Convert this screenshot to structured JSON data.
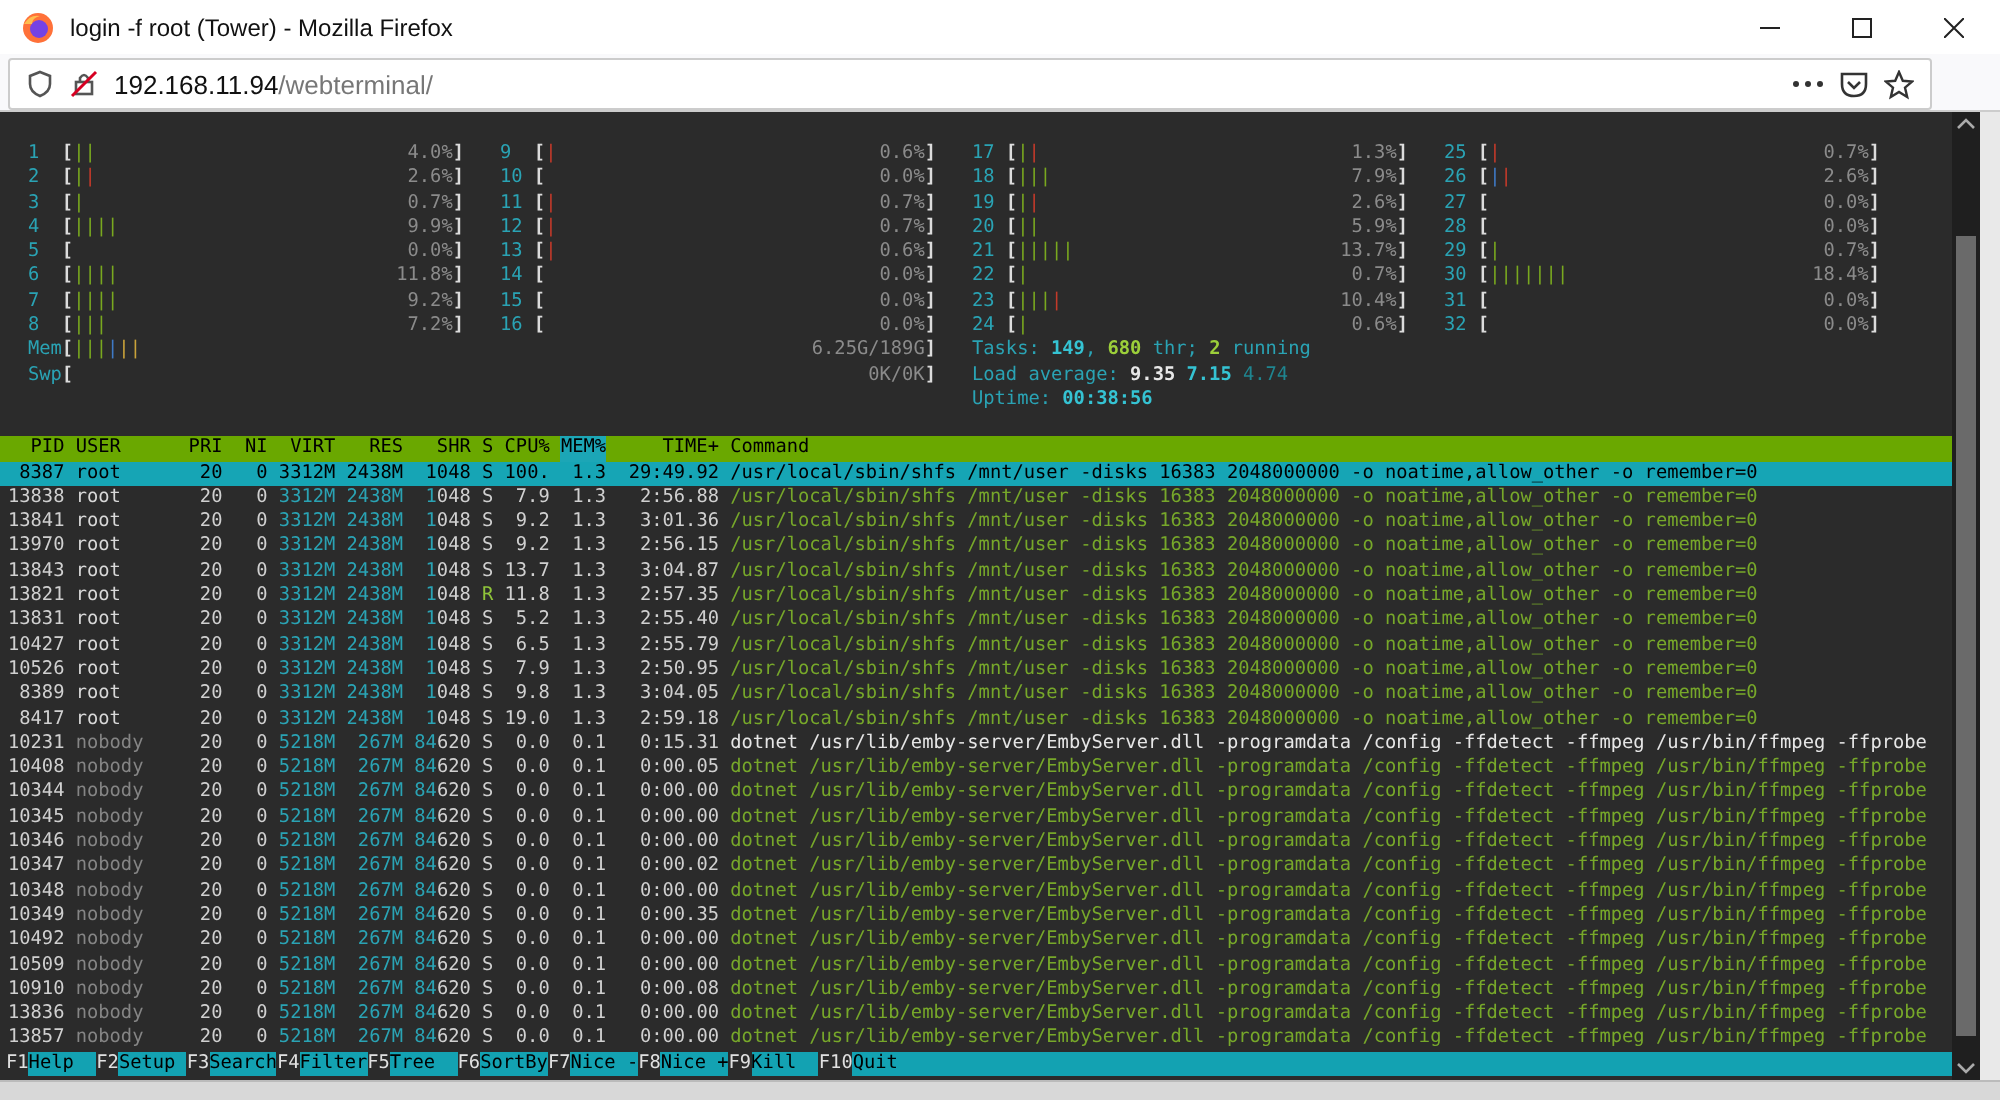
{
  "window": {
    "title": "login -f root (Tower) - Mozilla Firefox"
  },
  "address_bar": {
    "host": "192.168.11.94",
    "path": "/webterminal/"
  },
  "terminal": {
    "cpu_meters": [
      {
        "label": "1",
        "open": "[",
        "bars": [
          {
            "kind": "normal",
            "text": "||"
          }
        ],
        "reading": "4.0%",
        "close": "]"
      },
      {
        "label": "2",
        "open": "[",
        "bars": [
          {
            "kind": "normal",
            "text": "|"
          },
          {
            "kind": "kernel",
            "text": "|"
          }
        ],
        "reading": "2.6%",
        "close": "]"
      },
      {
        "label": "3",
        "open": "[",
        "bars": [
          {
            "kind": "normal",
            "text": "|"
          }
        ],
        "reading": "0.7%",
        "close": "]"
      },
      {
        "label": "4",
        "open": "[",
        "bars": [
          {
            "kind": "normal",
            "text": "||||"
          }
        ],
        "reading": "9.9%",
        "close": "]"
      },
      {
        "label": "5",
        "open": "[",
        "reading": "0.0%",
        "close": "]"
      },
      {
        "label": "6",
        "open": "[",
        "bars": [
          {
            "kind": "normal",
            "text": "||||"
          }
        ],
        "reading": "11.8%",
        "close": "]"
      },
      {
        "label": "7",
        "open": "[",
        "bars": [
          {
            "kind": "normal",
            "text": "||||"
          }
        ],
        "reading": "9.2%",
        "close": "]"
      },
      {
        "label": "8",
        "open": "[",
        "bars": [
          {
            "kind": "normal",
            "text": "|||"
          }
        ],
        "reading": "7.2%",
        "close": "]"
      },
      {
        "label": "9",
        "open": "[",
        "bars": [
          {
            "kind": "kernel",
            "text": "|"
          }
        ],
        "reading": "0.6%",
        "close": "]"
      },
      {
        "label": "10",
        "open": "[",
        "reading": "0.0%",
        "close": "]"
      },
      {
        "label": "11",
        "open": "[",
        "bars": [
          {
            "kind": "kernel",
            "text": "|"
          }
        ],
        "reading": "0.7%",
        "close": "]"
      },
      {
        "label": "12",
        "open": "[",
        "bars": [
          {
            "kind": "kernel",
            "text": "|"
          }
        ],
        "reading": "0.7%",
        "close": "]"
      },
      {
        "label": "13",
        "open": "[",
        "bars": [
          {
            "kind": "kernel",
            "text": "|"
          }
        ],
        "reading": "0.6%",
        "close": "]"
      },
      {
        "label": "14",
        "open": "[",
        "reading": "0.0%",
        "close": "]"
      },
      {
        "label": "15",
        "open": "[",
        "reading": "0.0%",
        "close": "]"
      },
      {
        "label": "16",
        "open": "[",
        "reading": "0.0%",
        "close": "]"
      },
      {
        "label": "17",
        "open": "[",
        "bars": [
          {
            "kind": "normal",
            "text": "|"
          },
          {
            "kind": "kernel",
            "text": "|"
          }
        ],
        "reading": "1.3%",
        "close": "]"
      },
      {
        "label": "18",
        "open": "[",
        "bars": [
          {
            "kind": "normal",
            "text": "|||"
          }
        ],
        "reading": "7.9%",
        "close": "]"
      },
      {
        "label": "19",
        "open": "[",
        "bars": [
          {
            "kind": "normal",
            "text": "|"
          },
          {
            "kind": "kernel",
            "text": "|"
          }
        ],
        "reading": "2.6%",
        "close": "]"
      },
      {
        "label": "20",
        "open": "[",
        "bars": [
          {
            "kind": "normal",
            "text": "||"
          }
        ],
        "reading": "5.9%",
        "close": "]"
      },
      {
        "label": "21",
        "open": "[",
        "bars": [
          {
            "kind": "normal",
            "text": "|||||"
          }
        ],
        "reading": "13.7%",
        "close": "]"
      },
      {
        "label": "22",
        "open": "[",
        "bars": [
          {
            "kind": "normal",
            "text": "|"
          }
        ],
        "reading": "0.7%",
        "close": "]"
      },
      {
        "label": "23",
        "open": "[",
        "bars": [
          {
            "kind": "normal",
            "text": "|||"
          },
          {
            "kind": "kernel",
            "text": "|"
          }
        ],
        "reading": "10.4%",
        "close": "]"
      },
      {
        "label": "24",
        "open": "[",
        "bars": [
          {
            "kind": "normal",
            "text": "|"
          }
        ],
        "reading": "0.6%",
        "close": "]"
      },
      {
        "label": "25",
        "open": "[",
        "bars": [
          {
            "kind": "kernel",
            "text": "|"
          }
        ],
        "reading": "0.7%",
        "close": "]"
      },
      {
        "label": "26",
        "open": "[",
        "bars": [
          {
            "kind": "low",
            "text": "|"
          },
          {
            "kind": "kernel",
            "text": "|"
          }
        ],
        "reading": "2.6%",
        "close": "]"
      },
      {
        "label": "27",
        "open": "[",
        "reading": "0.0%",
        "close": "]"
      },
      {
        "label": "28",
        "open": "[",
        "reading": "0.0%",
        "close": "]"
      },
      {
        "label": "29",
        "open": "[",
        "bars": [
          {
            "kind": "normal",
            "text": "|"
          }
        ],
        "reading": "0.7%",
        "close": "]"
      },
      {
        "label": "30",
        "open": "[",
        "bars": [
          {
            "kind": "normal",
            "text": "|||||||"
          }
        ],
        "reading": "18.4%",
        "close": "]"
      },
      {
        "label": "31",
        "open": "[",
        "reading": "0.0%",
        "close": "]"
      },
      {
        "label": "32",
        "open": "[",
        "reading": "0.0%",
        "close": "]"
      }
    ],
    "memory_meters": [
      {
        "label": "Mem",
        "open": "[",
        "bars": [
          {
            "kind": "normal",
            "text": "|||"
          },
          {
            "kind": "low",
            "text": "|"
          },
          {
            "kind": "cache",
            "text": "||"
          }
        ],
        "reading": "6.25G/189G",
        "close": "]"
      },
      {
        "label": "Swp",
        "open": "[",
        "reading": "0K/0K",
        "close": "]"
      }
    ],
    "summary": [
      {
        "segments": [
          {
            "kind": "label",
            "text": "Tasks: "
          },
          {
            "kind": "value",
            "text": "149"
          },
          {
            "kind": "label",
            "text": ", "
          },
          {
            "kind": "accent",
            "text": "680"
          },
          {
            "kind": "label",
            "text": " thr; "
          },
          {
            "kind": "accent",
            "text": "2"
          },
          {
            "kind": "label",
            "text": " running"
          }
        ]
      },
      {
        "segments": [
          {
            "kind": "label",
            "text": "Load average: "
          },
          {
            "kind": "bright",
            "text": "9.35 "
          },
          {
            "kind": "value",
            "text": "7.15 "
          },
          {
            "kind": "dim",
            "text": "4.74"
          }
        ]
      },
      {
        "segments": [
          {
            "kind": "label",
            "text": "Uptime: "
          },
          {
            "kind": "value",
            "text": "00:38:56"
          }
        ]
      }
    ],
    "table": {
      "columns": [
        {
          "label": "PID",
          "selected": false
        },
        {
          "label": "USER",
          "selected": false
        },
        {
          "label": "PRI",
          "selected": false
        },
        {
          "label": "NI",
          "selected": false
        },
        {
          "label": "VIRT",
          "selected": false
        },
        {
          "label": "RES",
          "selected": false
        },
        {
          "label": "SHR",
          "selected": false
        },
        {
          "label": "S",
          "selected": false
        },
        {
          "label": "CPU%",
          "selected": false
        },
        {
          "label": "MEM%",
          "selected": true
        },
        {
          "label": "TIME+",
          "selected": false
        },
        {
          "label": "Command",
          "selected": false
        }
      ],
      "rows": [
        {
          "pid": "8387",
          "user": "root",
          "pri": "20",
          "ni": "0",
          "virt": "3312M",
          "res": "2438M",
          "shr": "1048",
          "state": "S",
          "cpu": "100.",
          "mem": "1.3",
          "time": "29:49.92",
          "command": "/usr/local/sbin/shfs /mnt/user -disks 16383 2048000000 -o noatime,allow_other -o remember=0",
          "selected": true,
          "thread": false,
          "running": false,
          "other_user": false
        },
        {
          "pid": "13838",
          "user": "root",
          "pri": "20",
          "ni": "0",
          "virt": "3312M",
          "res": "2438M",
          "shr": "1048",
          "state": "S",
          "cpu": "7.9",
          "mem": "1.3",
          "time": "2:56.88",
          "command": "/usr/local/sbin/shfs /mnt/user -disks 16383 2048000000 -o noatime,allow_other -o remember=0",
          "selected": false,
          "thread": true,
          "running": false,
          "other_user": false
        },
        {
          "pid": "13841",
          "user": "root",
          "pri": "20",
          "ni": "0",
          "virt": "3312M",
          "res": "2438M",
          "shr": "1048",
          "state": "S",
          "cpu": "9.2",
          "mem": "1.3",
          "time": "3:01.36",
          "command": "/usr/local/sbin/shfs /mnt/user -disks 16383 2048000000 -o noatime,allow_other -o remember=0",
          "selected": false,
          "thread": true,
          "running": false,
          "other_user": false
        },
        {
          "pid": "13970",
          "user": "root",
          "pri": "20",
          "ni": "0",
          "virt": "3312M",
          "res": "2438M",
          "shr": "1048",
          "state": "S",
          "cpu": "9.2",
          "mem": "1.3",
          "time": "2:56.15",
          "command": "/usr/local/sbin/shfs /mnt/user -disks 16383 2048000000 -o noatime,allow_other -o remember=0",
          "selected": false,
          "thread": true,
          "running": false,
          "other_user": false
        },
        {
          "pid": "13843",
          "user": "root",
          "pri": "20",
          "ni": "0",
          "virt": "3312M",
          "res": "2438M",
          "shr": "1048",
          "state": "S",
          "cpu": "13.7",
          "mem": "1.3",
          "time": "3:04.87",
          "command": "/usr/local/sbin/shfs /mnt/user -disks 16383 2048000000 -o noatime,allow_other -o remember=0",
          "selected": false,
          "thread": true,
          "running": false,
          "other_user": false
        },
        {
          "pid": "13821",
          "user": "root",
          "pri": "20",
          "ni": "0",
          "virt": "3312M",
          "res": "2438M",
          "shr": "1048",
          "state": "R",
          "cpu": "11.8",
          "mem": "1.3",
          "time": "2:57.35",
          "command": "/usr/local/sbin/shfs /mnt/user -disks 16383 2048000000 -o noatime,allow_other -o remember=0",
          "selected": false,
          "thread": true,
          "running": true,
          "other_user": false
        },
        {
          "pid": "13831",
          "user": "root",
          "pri": "20",
          "ni": "0",
          "virt": "3312M",
          "res": "2438M",
          "shr": "1048",
          "state": "S",
          "cpu": "5.2",
          "mem": "1.3",
          "time": "2:55.40",
          "command": "/usr/local/sbin/shfs /mnt/user -disks 16383 2048000000 -o noatime,allow_other -o remember=0",
          "selected": false,
          "thread": true,
          "running": false,
          "other_user": false
        },
        {
          "pid": "10427",
          "user": "root",
          "pri": "20",
          "ni": "0",
          "virt": "3312M",
          "res": "2438M",
          "shr": "1048",
          "state": "S",
          "cpu": "6.5",
          "mem": "1.3",
          "time": "2:55.79",
          "command": "/usr/local/sbin/shfs /mnt/user -disks 16383 2048000000 -o noatime,allow_other -o remember=0",
          "selected": false,
          "thread": true,
          "running": false,
          "other_user": false
        },
        {
          "pid": "10526",
          "user": "root",
          "pri": "20",
          "ni": "0",
          "virt": "3312M",
          "res": "2438M",
          "shr": "1048",
          "state": "S",
          "cpu": "7.9",
          "mem": "1.3",
          "time": "2:50.95",
          "command": "/usr/local/sbin/shfs /mnt/user -disks 16383 2048000000 -o noatime,allow_other -o remember=0",
          "selected": false,
          "thread": true,
          "running": false,
          "other_user": false
        },
        {
          "pid": "8389",
          "user": "root",
          "pri": "20",
          "ni": "0",
          "virt": "3312M",
          "res": "2438M",
          "shr": "1048",
          "state": "S",
          "cpu": "9.8",
          "mem": "1.3",
          "time": "3:04.05",
          "command": "/usr/local/sbin/shfs /mnt/user -disks 16383 2048000000 -o noatime,allow_other -o remember=0",
          "selected": false,
          "thread": true,
          "running": false,
          "other_user": false
        },
        {
          "pid": "8417",
          "user": "root",
          "pri": "20",
          "ni": "0",
          "virt": "3312M",
          "res": "2438M",
          "shr": "1048",
          "state": "S",
          "cpu": "19.0",
          "mem": "1.3",
          "time": "2:59.18",
          "command": "/usr/local/sbin/shfs /mnt/user -disks 16383 2048000000 -o noatime,allow_other -o remember=0",
          "selected": false,
          "thread": true,
          "running": false,
          "other_user": false
        },
        {
          "pid": "10231",
          "user": "nobody",
          "pri": "20",
          "ni": "0",
          "virt": "5218M",
          "res": "267M",
          "shr": "84620",
          "state": "S",
          "cpu": "0.0",
          "mem": "0.1",
          "time": "0:15.31",
          "command": "dotnet /usr/lib/emby-server/EmbyServer.dll -programdata /config -ffdetect -ffmpeg /usr/bin/ffmpeg -ffprobe",
          "selected": false,
          "thread": false,
          "running": false,
          "other_user": true
        },
        {
          "pid": "10408",
          "user": "nobody",
          "pri": "20",
          "ni": "0",
          "virt": "5218M",
          "res": "267M",
          "shr": "84620",
          "state": "S",
          "cpu": "0.0",
          "mem": "0.1",
          "time": "0:00.05",
          "command": "dotnet /usr/lib/emby-server/EmbyServer.dll -programdata /config -ffdetect -ffmpeg /usr/bin/ffmpeg -ffprobe",
          "selected": false,
          "thread": true,
          "running": false,
          "other_user": true
        },
        {
          "pid": "10344",
          "user": "nobody",
          "pri": "20",
          "ni": "0",
          "virt": "5218M",
          "res": "267M",
          "shr": "84620",
          "state": "S",
          "cpu": "0.0",
          "mem": "0.1",
          "time": "0:00.00",
          "command": "dotnet /usr/lib/emby-server/EmbyServer.dll -programdata /config -ffdetect -ffmpeg /usr/bin/ffmpeg -ffprobe",
          "selected": false,
          "thread": true,
          "running": false,
          "other_user": true
        },
        {
          "pid": "10345",
          "user": "nobody",
          "pri": "20",
          "ni": "0",
          "virt": "5218M",
          "res": "267M",
          "shr": "84620",
          "state": "S",
          "cpu": "0.0",
          "mem": "0.1",
          "time": "0:00.00",
          "command": "dotnet /usr/lib/emby-server/EmbyServer.dll -programdata /config -ffdetect -ffmpeg /usr/bin/ffmpeg -ffprobe",
          "selected": false,
          "thread": true,
          "running": false,
          "other_user": true
        },
        {
          "pid": "10346",
          "user": "nobody",
          "pri": "20",
          "ni": "0",
          "virt": "5218M",
          "res": "267M",
          "shr": "84620",
          "state": "S",
          "cpu": "0.0",
          "mem": "0.1",
          "time": "0:00.00",
          "command": "dotnet /usr/lib/emby-server/EmbyServer.dll -programdata /config -ffdetect -ffmpeg /usr/bin/ffmpeg -ffprobe",
          "selected": false,
          "thread": true,
          "running": false,
          "other_user": true
        },
        {
          "pid": "10347",
          "user": "nobody",
          "pri": "20",
          "ni": "0",
          "virt": "5218M",
          "res": "267M",
          "shr": "84620",
          "state": "S",
          "cpu": "0.0",
          "mem": "0.1",
          "time": "0:00.02",
          "command": "dotnet /usr/lib/emby-server/EmbyServer.dll -programdata /config -ffdetect -ffmpeg /usr/bin/ffmpeg -ffprobe",
          "selected": false,
          "thread": true,
          "running": false,
          "other_user": true
        },
        {
          "pid": "10348",
          "user": "nobody",
          "pri": "20",
          "ni": "0",
          "virt": "5218M",
          "res": "267M",
          "shr": "84620",
          "state": "S",
          "cpu": "0.0",
          "mem": "0.1",
          "time": "0:00.00",
          "command": "dotnet /usr/lib/emby-server/EmbyServer.dll -programdata /config -ffdetect -ffmpeg /usr/bin/ffmpeg -ffprobe",
          "selected": false,
          "thread": true,
          "running": false,
          "other_user": true
        },
        {
          "pid": "10349",
          "user": "nobody",
          "pri": "20",
          "ni": "0",
          "virt": "5218M",
          "res": "267M",
          "shr": "84620",
          "state": "S",
          "cpu": "0.0",
          "mem": "0.1",
          "time": "0:00.35",
          "command": "dotnet /usr/lib/emby-server/EmbyServer.dll -programdata /config -ffdetect -ffmpeg /usr/bin/ffmpeg -ffprobe",
          "selected": false,
          "thread": true,
          "running": false,
          "other_user": true
        },
        {
          "pid": "10492",
          "user": "nobody",
          "pri": "20",
          "ni": "0",
          "virt": "5218M",
          "res": "267M",
          "shr": "84620",
          "state": "S",
          "cpu": "0.0",
          "mem": "0.1",
          "time": "0:00.00",
          "command": "dotnet /usr/lib/emby-server/EmbyServer.dll -programdata /config -ffdetect -ffmpeg /usr/bin/ffmpeg -ffprobe",
          "selected": false,
          "thread": true,
          "running": false,
          "other_user": true
        },
        {
          "pid": "10509",
          "user": "nobody",
          "pri": "20",
          "ni": "0",
          "virt": "5218M",
          "res": "267M",
          "shr": "84620",
          "state": "S",
          "cpu": "0.0",
          "mem": "0.1",
          "time": "0:00.00",
          "command": "dotnet /usr/lib/emby-server/EmbyServer.dll -programdata /config -ffdetect -ffmpeg /usr/bin/ffmpeg -ffprobe",
          "selected": false,
          "thread": true,
          "running": false,
          "other_user": true
        },
        {
          "pid": "10910",
          "user": "nobody",
          "pri": "20",
          "ni": "0",
          "virt": "5218M",
          "res": "267M",
          "shr": "84620",
          "state": "S",
          "cpu": "0.0",
          "mem": "0.1",
          "time": "0:00.08",
          "command": "dotnet /usr/lib/emby-server/EmbyServer.dll -programdata /config -ffdetect -ffmpeg /usr/bin/ffmpeg -ffprobe",
          "selected": false,
          "thread": true,
          "running": false,
          "other_user": true
        },
        {
          "pid": "13836",
          "user": "nobody",
          "pri": "20",
          "ni": "0",
          "virt": "5218M",
          "res": "267M",
          "shr": "84620",
          "state": "S",
          "cpu": "0.0",
          "mem": "0.1",
          "time": "0:00.00",
          "command": "dotnet /usr/lib/emby-server/EmbyServer.dll -programdata /config -ffdetect -ffmpeg /usr/bin/ffmpeg -ffprobe",
          "selected": false,
          "thread": true,
          "running": false,
          "other_user": true
        },
        {
          "pid": "13857",
          "user": "nobody",
          "pri": "20",
          "ni": "0",
          "virt": "5218M",
          "res": "267M",
          "shr": "84620",
          "state": "S",
          "cpu": "0.0",
          "mem": "0.1",
          "time": "0:00.00",
          "command": "dotnet /usr/lib/emby-server/EmbyServer.dll -programdata /config -ffdetect -ffmpeg /usr/bin/ffmpeg -ffprobe",
          "selected": false,
          "thread": true,
          "running": false,
          "other_user": true
        }
      ]
    },
    "function_keys": [
      {
        "key": "F1",
        "label": "Help"
      },
      {
        "key": "F2",
        "label": "Setup"
      },
      {
        "key": "F3",
        "label": "Search"
      },
      {
        "key": "F4",
        "label": "Filter"
      },
      {
        "key": "F5",
        "label": "Tree"
      },
      {
        "key": "F6",
        "label": "SortBy"
      },
      {
        "key": "F7",
        "label": "Nice -"
      },
      {
        "key": "F8",
        "label": "Nice +"
      },
      {
        "key": "F9",
        "label": "Kill"
      },
      {
        "key": "F10",
        "label": "Quit"
      }
    ]
  }
}
